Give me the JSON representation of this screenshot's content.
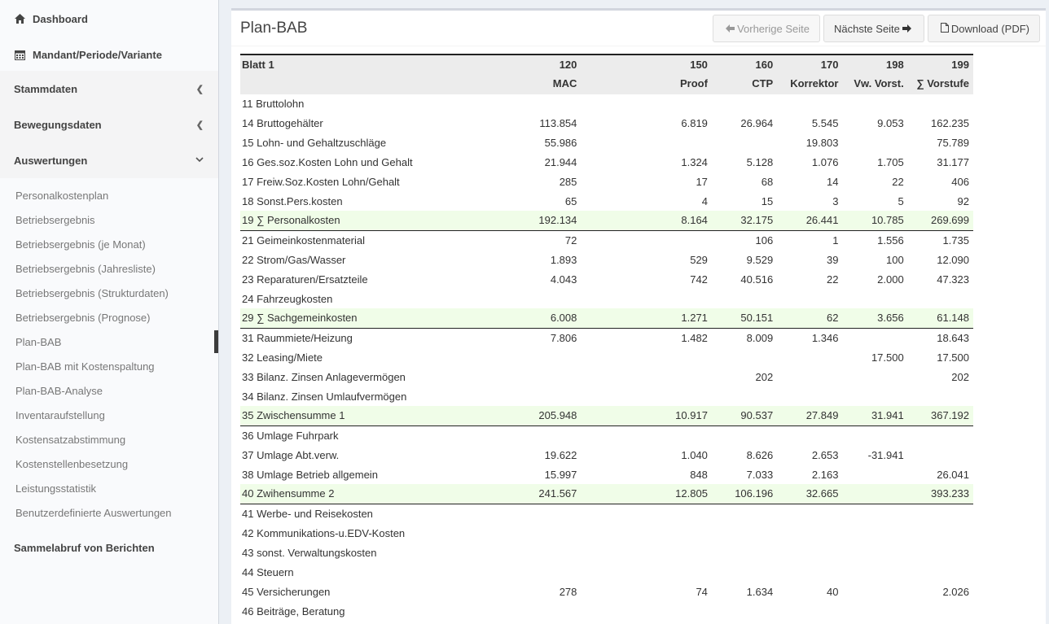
{
  "sidebar": {
    "top": [
      {
        "label": "Dashboard",
        "icon": "home-icon"
      },
      {
        "label": "Mandant/Periode/Variante",
        "icon": "calendar-icon"
      }
    ],
    "sections": [
      {
        "label": "Stammdaten",
        "chevron": "<"
      },
      {
        "label": "Bewegungsdaten",
        "chevron": "<"
      },
      {
        "label": "Auswertungen",
        "chevron": "⌄"
      }
    ],
    "sub_items": [
      "Personalkostenplan",
      "Betriebsergebnis",
      "Betriebsergebnis (je Monat)",
      "Betriebsergebnis (Jahresliste)",
      "Betriebsergebnis (Strukturdaten)",
      "Betriebsergebnis (Prognose)",
      "Plan-BAB",
      "Plan-BAB mit Kostenspaltung",
      "Plan-BAB-Analyse",
      "Inventaraufstellung",
      "Kostensatzabstimmung",
      "Kostenstellenbesetzung",
      "Leistungsstatistik",
      "Benutzerdefinierte Auswertungen"
    ],
    "active_sub_item": "Plan-BAB",
    "last": "Sammelabruf von Berichten"
  },
  "page": {
    "title": "Plan-BAB",
    "prev_label": "Vorherige Seite",
    "next_label": "Nächste Seite",
    "download_label": "Download (PDF)"
  },
  "table": {
    "header1": [
      "Blatt 1",
      "120",
      "",
      "150",
      "160",
      "170",
      "198",
      "199"
    ],
    "header2": [
      "",
      "MAC",
      "",
      "Proof",
      "CTP",
      "Korrektor",
      "Vw. Vorst.",
      "∑ Vorstufe"
    ],
    "rows": [
      {
        "cells": [
          "11 Bruttolohn",
          "",
          "",
          "",
          "",
          "",
          "",
          ""
        ],
        "sum": false
      },
      {
        "cells": [
          "14 Bruttogehälter",
          "113.854",
          "",
          "6.819",
          "26.964",
          "5.545",
          "9.053",
          "162.235"
        ],
        "sum": false
      },
      {
        "cells": [
          "15 Lohn- und Gehaltzuschläge",
          "55.986",
          "",
          "",
          "",
          "19.803",
          "",
          "75.789"
        ],
        "sum": false
      },
      {
        "cells": [
          "16 Ges.soz.Kosten Lohn und Gehalt",
          "21.944",
          "",
          "1.324",
          "5.128",
          "1.076",
          "1.705",
          "31.177"
        ],
        "sum": false
      },
      {
        "cells": [
          "17 Freiw.Soz.Kosten Lohn/Gehalt",
          "285",
          "",
          "17",
          "68",
          "14",
          "22",
          "406"
        ],
        "sum": false
      },
      {
        "cells": [
          "18 Sonst.Pers.kosten",
          "65",
          "",
          "4",
          "15",
          "3",
          "5",
          "92"
        ],
        "sum": false
      },
      {
        "cells": [
          "19 ∑ Personalkosten",
          "192.134",
          "",
          "8.164",
          "32.175",
          "26.441",
          "10.785",
          "269.699"
        ],
        "sum": true
      },
      {
        "cells": [
          "21 Geimeinkostenmaterial",
          "72",
          "",
          "",
          "106",
          "1",
          "1.556",
          "1.735"
        ],
        "sum": false
      },
      {
        "cells": [
          "22 Strom/Gas/Wasser",
          "1.893",
          "",
          "529",
          "9.529",
          "39",
          "100",
          "12.090"
        ],
        "sum": false
      },
      {
        "cells": [
          "23 Reparaturen/Ersatzteile",
          "4.043",
          "",
          "742",
          "40.516",
          "22",
          "2.000",
          "47.323"
        ],
        "sum": false
      },
      {
        "cells": [
          "24 Fahrzeugkosten",
          "",
          "",
          "",
          "",
          "",
          "",
          ""
        ],
        "sum": false
      },
      {
        "cells": [
          "29 ∑ Sachgemeinkosten",
          "6.008",
          "",
          "1.271",
          "50.151",
          "62",
          "3.656",
          "61.148"
        ],
        "sum": true
      },
      {
        "cells": [
          "31 Raummiete/Heizung",
          "7.806",
          "",
          "1.482",
          "8.009",
          "1.346",
          "",
          "18.643"
        ],
        "sum": false
      },
      {
        "cells": [
          "32 Leasing/Miete",
          "",
          "",
          "",
          "",
          "",
          "17.500",
          "17.500"
        ],
        "sum": false
      },
      {
        "cells": [
          "33 Bilanz. Zinsen Anlagevermögen",
          "",
          "",
          "",
          "202",
          "",
          "",
          "202"
        ],
        "sum": false
      },
      {
        "cells": [
          "34 Bilanz. Zinsen Umlaufvermögen",
          "",
          "",
          "",
          "",
          "",
          "",
          ""
        ],
        "sum": false
      },
      {
        "cells": [
          "35 Zwischensumme 1",
          "205.948",
          "",
          "10.917",
          "90.537",
          "27.849",
          "31.941",
          "367.192"
        ],
        "sum": true
      },
      {
        "cells": [
          "36 Umlage Fuhrpark",
          "",
          "",
          "",
          "",
          "",
          "",
          ""
        ],
        "sum": false
      },
      {
        "cells": [
          "37 Umlage Abt.verw.",
          "19.622",
          "",
          "1.040",
          "8.626",
          "2.653",
          "-31.941",
          ""
        ],
        "sum": false
      },
      {
        "cells": [
          "38 Umlage Betrieb allgemein",
          "15.997",
          "",
          "848",
          "7.033",
          "2.163",
          "",
          "26.041"
        ],
        "sum": false
      },
      {
        "cells": [
          "40 Zwihensumme 2",
          "241.567",
          "",
          "12.805",
          "106.196",
          "32.665",
          "",
          "393.233"
        ],
        "sum": true
      },
      {
        "cells": [
          "41 Werbe- und Reisekosten",
          "",
          "",
          "",
          "",
          "",
          "",
          ""
        ],
        "sum": false
      },
      {
        "cells": [
          "42 Kommunikations-u.EDV-Kosten",
          "",
          "",
          "",
          "",
          "",
          "",
          ""
        ],
        "sum": false
      },
      {
        "cells": [
          "43 sonst. Verwaltungskosten",
          "",
          "",
          "",
          "",
          "",
          "",
          ""
        ],
        "sum": false
      },
      {
        "cells": [
          "44 Steuern",
          "",
          "",
          "",
          "",
          "",
          "",
          ""
        ],
        "sum": false
      },
      {
        "cells": [
          "45 Versicherungen",
          "278",
          "",
          "74",
          "1.634",
          "40",
          "",
          "2.026"
        ],
        "sum": false
      },
      {
        "cells": [
          "46 Beiträge, Beratung",
          "",
          "",
          "",
          "",
          "",
          "",
          ""
        ],
        "sum": false
      }
    ]
  }
}
